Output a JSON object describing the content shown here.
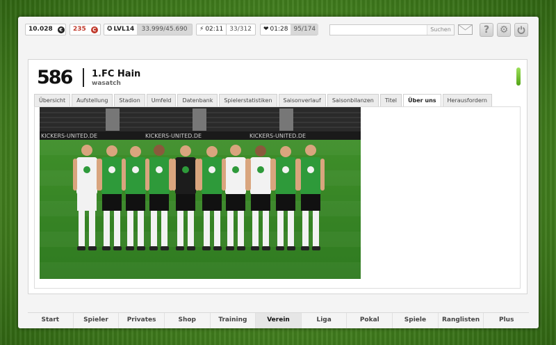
{
  "topbar": {
    "money": "10.028",
    "money_icon": "€",
    "credits": "235",
    "credits_icon": "C",
    "level": "LVL14",
    "xp": "33.999/45.690",
    "energy_timer": "02:11",
    "energy": "33/312",
    "fitness_timer": "01:28",
    "fitness": "95/174",
    "search_placeholder": "",
    "search_button": "Suchen"
  },
  "club": {
    "rank": "586",
    "name": "1.FC Hain",
    "owner": "wasatch"
  },
  "tabs": [
    {
      "label": "Übersicht"
    },
    {
      "label": "Aufstellung"
    },
    {
      "label": "Stadion"
    },
    {
      "label": "Umfeld"
    },
    {
      "label": "Datenbank"
    },
    {
      "label": "Spielerstatistiken"
    },
    {
      "label": "Saisonverlauf"
    },
    {
      "label": "Saisonbilanzen"
    },
    {
      "label": "Titel"
    },
    {
      "label": "Über uns",
      "active": true
    },
    {
      "label": "Herausfordern"
    }
  ],
  "banner_text": "KICKERS-UNITED.DE",
  "nav": [
    {
      "label": "Start"
    },
    {
      "label": "Spieler"
    },
    {
      "label": "Privates"
    },
    {
      "label": "Shop"
    },
    {
      "label": "Training"
    },
    {
      "label": "Verein",
      "active": true
    },
    {
      "label": "Liga"
    },
    {
      "label": "Pokal"
    },
    {
      "label": "Spiele"
    },
    {
      "label": "Ranglisten"
    },
    {
      "label": "Plus"
    }
  ],
  "colors": {
    "green": "#2e9a3a",
    "credit_red": "#c0392b",
    "meter": "#6cc428"
  }
}
